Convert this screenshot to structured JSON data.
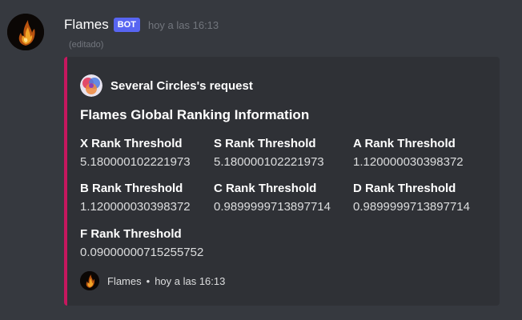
{
  "message": {
    "username": "Flames",
    "bot_tag": "BOT",
    "timestamp": "hoy a las 16:13",
    "edited": "(editado)"
  },
  "embed": {
    "accent_color": "#c6175e",
    "author": "Several Circles's request",
    "title": "Flames Global Ranking Information",
    "fields": [
      {
        "name": "X Rank Threshold",
        "value": "5.180000102221973"
      },
      {
        "name": "S Rank Threshold",
        "value": "5.180000102221973"
      },
      {
        "name": "A Rank Threshold",
        "value": "1.120000030398372"
      },
      {
        "name": "B Rank Threshold",
        "value": "1.120000030398372"
      },
      {
        "name": "C Rank Threshold",
        "value": "0.9899999713897714"
      },
      {
        "name": "D Rank Threshold",
        "value": "0.9899999713897714"
      },
      {
        "name": "F Rank Threshold",
        "value": "0.09000000715255752"
      }
    ],
    "footer": {
      "name": "Flames",
      "separator": "•",
      "timestamp": "hoy a las 16:13"
    }
  },
  "icons": {
    "bot_avatar": "flame-avatar-icon",
    "author_icon": "circles-logo-icon",
    "footer_avatar": "flame-avatar-icon"
  }
}
